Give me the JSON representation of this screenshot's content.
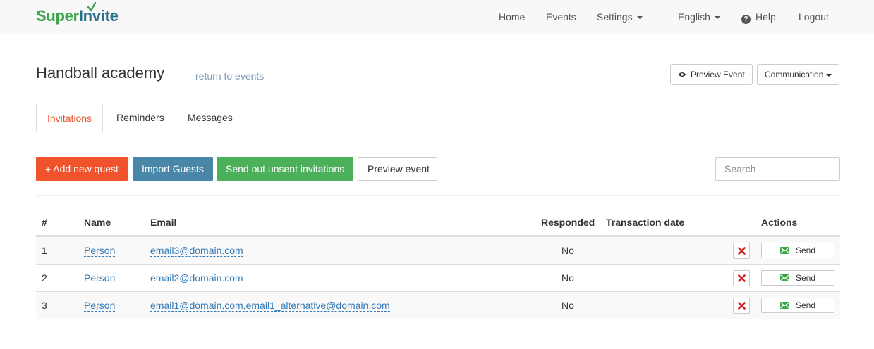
{
  "navbar": {
    "brand_part1": "Super",
    "brand_part2": "Invite",
    "links": {
      "home": "Home",
      "events": "Events",
      "settings": "Settings",
      "language": "English",
      "help": "Help",
      "logout": "Logout"
    },
    "brand_colors": {
      "green": "#3aa648",
      "blue": "#2b6f8a"
    }
  },
  "header": {
    "title": "Handball academy",
    "return_link": "return to events",
    "preview_event_label": "Preview Event",
    "communication_label": "Communication"
  },
  "tabs": [
    {
      "label": "Invitations",
      "active": true
    },
    {
      "label": "Reminders",
      "active": false
    },
    {
      "label": "Messages",
      "active": false
    }
  ],
  "actions": {
    "add_guest": "+ Add new quest",
    "import_guests": "Import Guests",
    "send_unsent": "Send out unsent invitations",
    "preview_event": "Preview event",
    "search_placeholder": "Search",
    "colors": {
      "orange": "#f0522b",
      "blue": "#4a86a8",
      "green": "#4cb05a"
    }
  },
  "table": {
    "headers": {
      "number": "#",
      "name": "Name",
      "email": "Email",
      "responded": "Responded",
      "transaction_date": "Transaction date",
      "actions": "Actions"
    },
    "send_label": "Send",
    "rows": [
      {
        "number": "1",
        "name": "Person",
        "email": "email3@domain.com",
        "responded": "No",
        "transaction_date": ""
      },
      {
        "number": "2",
        "name": "Person",
        "email": "email2@domain.com",
        "responded": "No",
        "transaction_date": ""
      },
      {
        "number": "3",
        "name": "Person",
        "email": "email1@domain.com,email1_alternative@domain.com",
        "responded": "No",
        "transaction_date": ""
      }
    ]
  }
}
